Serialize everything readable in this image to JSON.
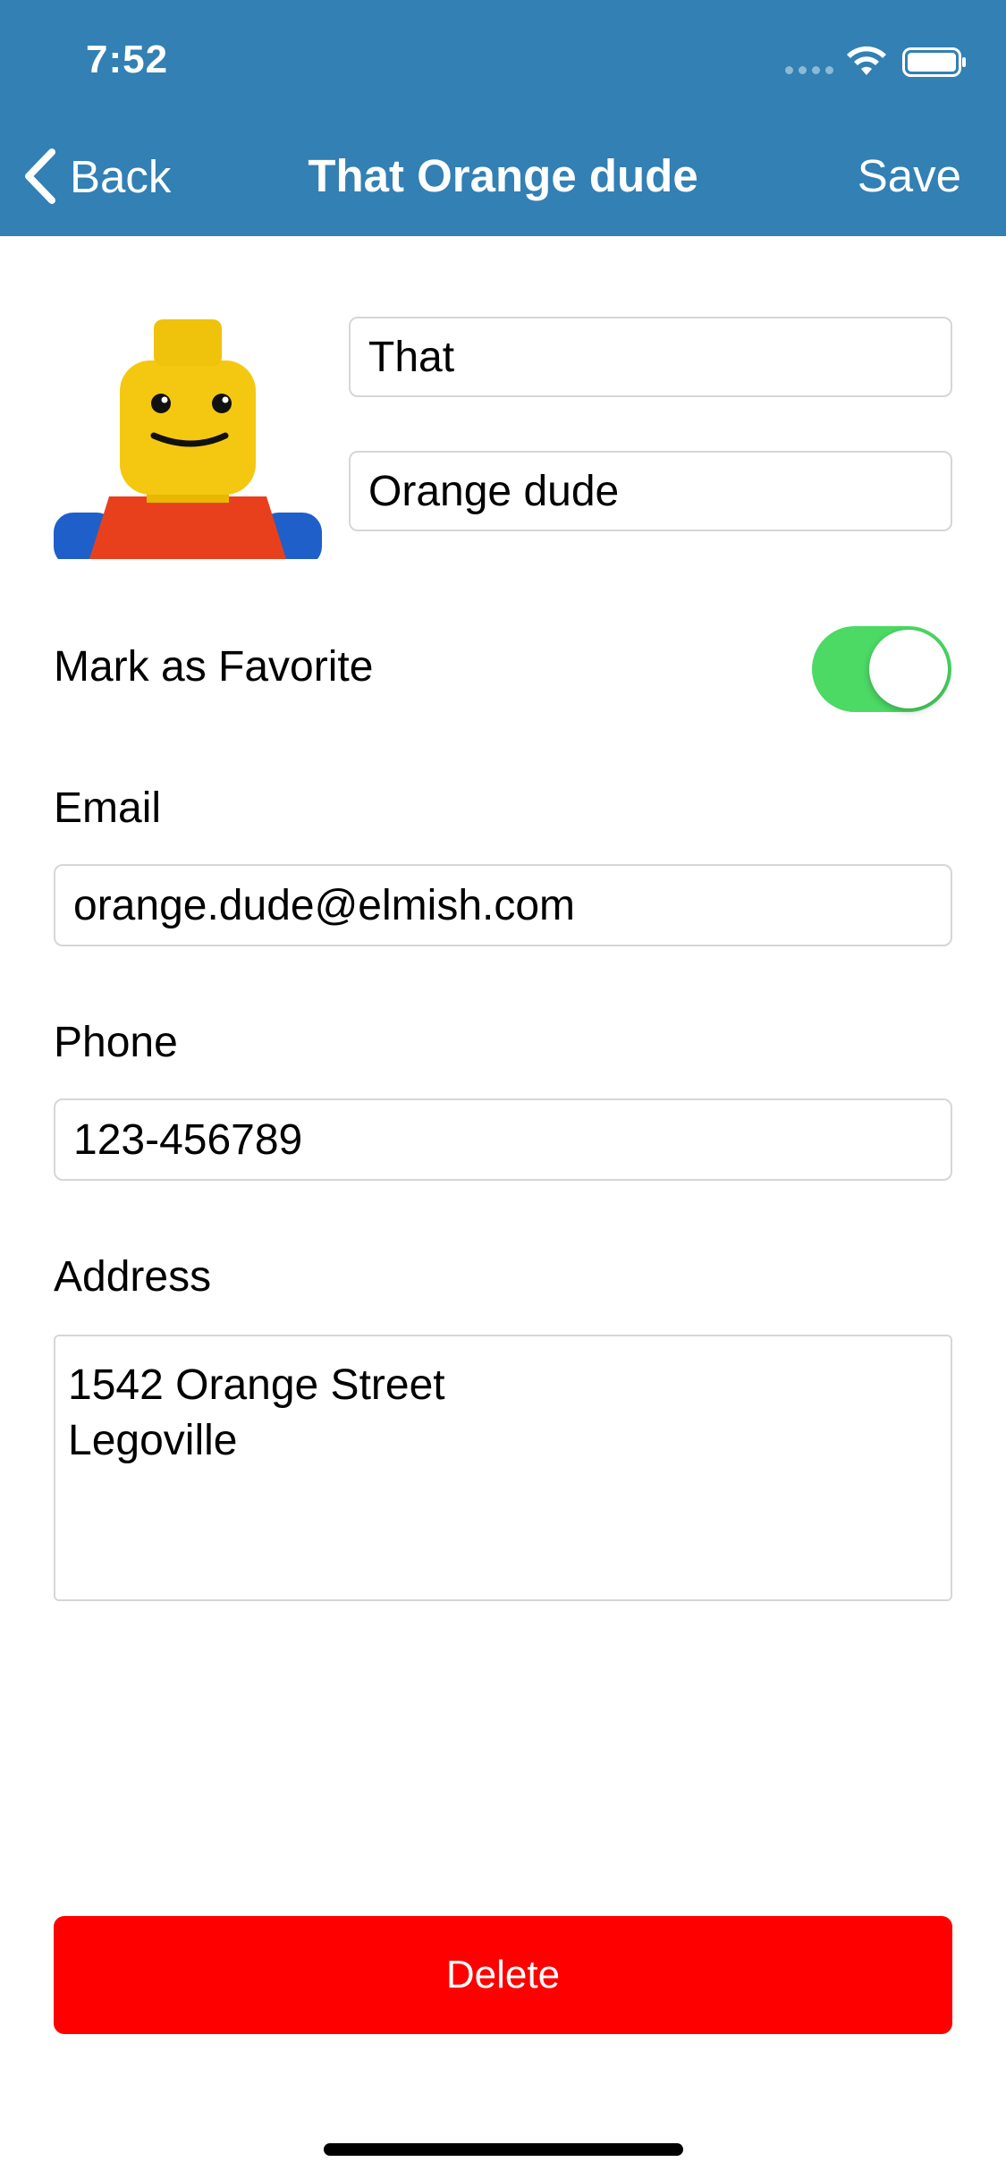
{
  "status_bar": {
    "time": "7:52",
    "icons": [
      "signal-dots-icon",
      "wifi-icon",
      "battery-icon"
    ]
  },
  "nav": {
    "back_label": "Back",
    "title": "That Orange dude",
    "save_label": "Save"
  },
  "contact": {
    "avatar": "lego-minifigure-avatar",
    "first_name": "That",
    "last_name": "Orange dude"
  },
  "favorite": {
    "label": "Mark as Favorite",
    "enabled": true
  },
  "email": {
    "label": "Email",
    "value": "orange.dude@elmish.com"
  },
  "phone": {
    "label": "Phone",
    "value": "123-456789"
  },
  "address": {
    "label": "Address",
    "value": "1542 Orange Street\nLegoville"
  },
  "delete_label": "Delete",
  "colors": {
    "header": "#3280b4",
    "toggle_on": "#4cd964",
    "delete": "#ff0000"
  }
}
